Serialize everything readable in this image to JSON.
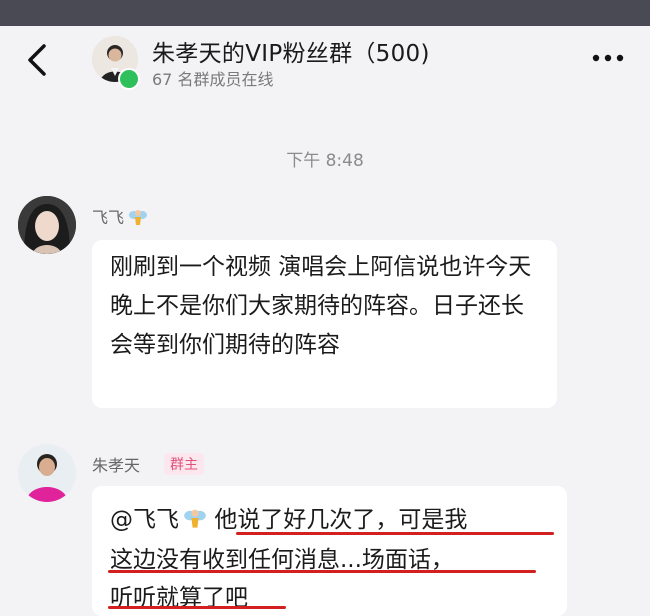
{
  "header": {
    "title": "朱孝天的VIP粉丝群（500)",
    "subtitle": "67 名群成员在线"
  },
  "chat": {
    "timestamp": "下午 8:48",
    "messages": [
      {
        "sender": "飞飞",
        "text": "刚刷到一个视频 演唱会上阿信说也许今天晚上不是你们大家期待的阵容。日子还长 会等到你们期待的阵容"
      },
      {
        "sender": "朱孝天",
        "badge": "群主",
        "mention": "@飞飞",
        "line1": "他说了好几次了，可是我",
        "line2": "这边没有收到任何消息...场面话，",
        "line3": "听听就算了吧"
      }
    ]
  },
  "colors": {
    "online": "#2ec05a",
    "badge_text": "#e0527c",
    "underline": "#d21f1f"
  }
}
